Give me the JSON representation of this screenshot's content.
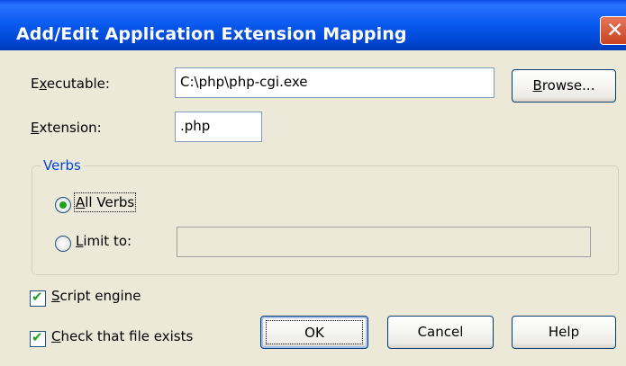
{
  "window": {
    "title": "Add/Edit Application Extension Mapping",
    "close_glyph": "✕"
  },
  "executable": {
    "label_prefix": "E",
    "label_mnemonic": "x",
    "label_rest": "ecutable:",
    "value": "C:\\php\\php-cgi.exe",
    "browse_mnemonic": "B",
    "browse_rest": "rowse..."
  },
  "extension": {
    "label_mnemonic": "E",
    "label_rest": "xtension:",
    "value": ".php"
  },
  "verbs": {
    "legend": "Verbs",
    "all_verbs": {
      "mnemonic": "A",
      "rest": "ll Verbs",
      "selected": true
    },
    "limit_to": {
      "mnemonic": "L",
      "rest": "imit to:",
      "selected": false,
      "value": ""
    }
  },
  "options": {
    "script_engine": {
      "mnemonic": "S",
      "rest": "cript engine",
      "checked": true
    },
    "check_file": {
      "mnemonic": "C",
      "rest": "heck that file exists",
      "checked": true
    }
  },
  "buttons": {
    "ok": "OK",
    "cancel": "Cancel",
    "help": "Help"
  },
  "colors": {
    "title_bar": "#0b5cf0",
    "dialog_bg": "#ece9d8",
    "group_legend": "#0046d5",
    "check_accent": "#21a121"
  }
}
